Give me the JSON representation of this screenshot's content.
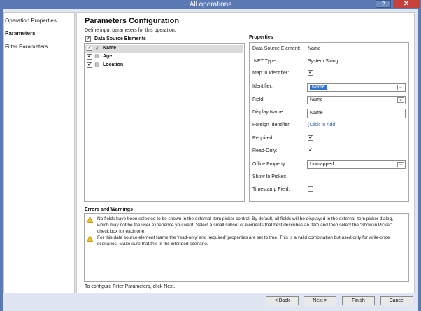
{
  "window": {
    "title": "All operations",
    "help_label": "?",
    "close_label": "✕"
  },
  "sidebar": {
    "items": [
      {
        "label": "Operation Properties",
        "active": false
      },
      {
        "label": "Parameters",
        "active": true
      },
      {
        "label": "Filter Parameters",
        "active": false
      }
    ]
  },
  "main": {
    "title": "Parameters Configuration",
    "description": "Define input parameters for this operation.",
    "data_source": {
      "header_label": "Data Source Elements",
      "header_checked": true,
      "elements": [
        {
          "label": "Name",
          "checked": true,
          "icon": "identifier-key-icon",
          "selected": true
        },
        {
          "label": "Age",
          "checked": true,
          "icon": "field-icon",
          "selected": false
        },
        {
          "label": "Location",
          "checked": true,
          "icon": "field-icon",
          "selected": false
        }
      ]
    },
    "properties": {
      "title": "Properties",
      "data_source_element_label": "Data Source Element:",
      "data_source_element_value": "Name",
      "net_type_label": ".NET Type:",
      "net_type_value": "System.String",
      "map_to_identifier_label": "Map to Identifier:",
      "map_to_identifier_checked": true,
      "identifier_label": "Identifier:",
      "identifier_value": "Name",
      "field_label": "Field:",
      "field_value": "Name",
      "display_name_label": "Display Name:",
      "display_name_value": "Name",
      "foreign_identifier_label": "Foreign Identifier:",
      "foreign_identifier_link": "(Click to Add)",
      "required_label": "Required:",
      "required_checked": true,
      "read_only_label": "Read-Only:",
      "read_only_checked": true,
      "office_property_label": "Office Property:",
      "office_property_value": "Unmapped",
      "show_in_picker_label": "Show In Picker:",
      "show_in_picker_checked": false,
      "timestamp_field_label": "Timestamp Field:",
      "timestamp_field_checked": false
    },
    "errors": {
      "title": "Errors and Warnings",
      "warnings": [
        {
          "icon": "warning-icon",
          "text": "No fields have been selected to be shown in the external item picker control. By default, all fields will be displayed in the external item picker dialog, which may not be the user experience you want. Select a small subset of elements that best describes an item and then select the 'Show in Picker' check box for each one."
        },
        {
          "icon": "warning-icon",
          "text": "For this data source element Name the 'read-only' and 'required' properties are set to true. This is a valid combination but used only for write-once scenarios. Make sure that this is the intended scenario."
        }
      ]
    },
    "footer_hint": "To configure Filter Parameters, click Next."
  },
  "buttons": {
    "back": "< Back",
    "next": "Next >",
    "finish": "Finish",
    "cancel": "Cancel"
  },
  "colors": {
    "title_bar": "#5b79b3",
    "close_button": "#c7413a",
    "selection_highlight": "#3272d0",
    "link": "#3b5fa0",
    "warning_yellow": "#f2c21b"
  }
}
